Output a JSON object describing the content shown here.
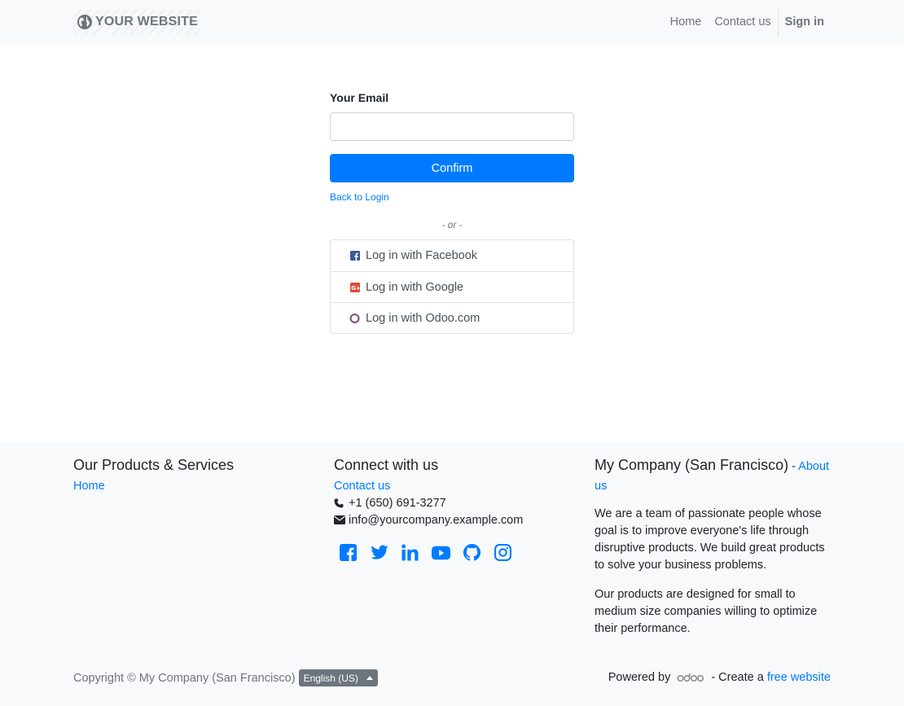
{
  "header": {
    "logo_text": "YOUR WEBSITE",
    "nav": {
      "home": "Home",
      "contact": "Contact us",
      "signin": "Sign in"
    }
  },
  "form": {
    "email_label": "Your Email",
    "email_value": "",
    "confirm_label": "Confirm",
    "back_link": "Back to Login",
    "or_text": "- or -",
    "oauth": [
      {
        "label": "Log in with Facebook",
        "icon": "facebook-icon"
      },
      {
        "label": "Log in with Google",
        "icon": "google-plus-icon"
      },
      {
        "label": "Log in with Odoo.com",
        "icon": "odoo-circle-icon"
      }
    ]
  },
  "footer": {
    "col1": {
      "title": "Our Products & Services",
      "home": "Home"
    },
    "col2": {
      "title": "Connect with us",
      "contact": "Contact us",
      "phone": "+1 (650) 691-3277",
      "email": "info@yourcompany.example.com",
      "socials": [
        "facebook-icon",
        "twitter-icon",
        "linkedin-icon",
        "youtube-icon",
        "github-icon",
        "instagram-icon"
      ]
    },
    "col3": {
      "company": "My Company (San Francisco)",
      "dash": " - ",
      "about": "About us",
      "p1": "We are a team of passionate people whose goal is to improve everyone's life through disruptive products. We build great products to solve your business problems.",
      "p2": "Our products are designed for small to medium size companies willing to optimize their performance."
    },
    "copyright": "Copyright © My Company (San Francisco)",
    "language": "English (US)",
    "powered_by": "Powered by",
    "create_text": "- Create a",
    "free_website": "free website"
  },
  "colors": {
    "primary": "#007bff",
    "muted": "#6c757d",
    "footer_bg": "#f8f9fa",
    "facebook": "#3b5998",
    "google": "#dd4b39",
    "odoo": "#875a7b"
  }
}
